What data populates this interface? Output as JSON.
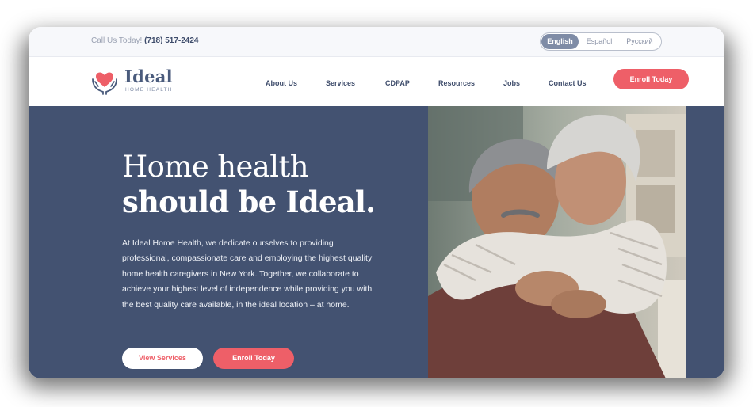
{
  "topbar": {
    "call_label": "Call Us Today!",
    "phone": "(718) 517-2424",
    "languages": [
      {
        "label": "English",
        "active": true
      },
      {
        "label": "Español",
        "active": false
      },
      {
        "label": "Русский",
        "active": false
      }
    ]
  },
  "brand": {
    "name": "Ideal",
    "subtitle": "HOME HEALTH",
    "icon": "heart-in-hands-icon",
    "accent_color": "#ee5f68",
    "navy_color": "#435271"
  },
  "nav": {
    "items": [
      "About Us",
      "Services",
      "CDPAP",
      "Resources",
      "Jobs",
      "Contact Us"
    ],
    "cta": "Enroll Today"
  },
  "hero": {
    "headline_line1": "Home health",
    "headline_line2": "should be Ideal.",
    "description": "At Ideal Home Health, we dedicate ourselves to providing professional, compassionate care and employing the highest quality home health caregivers in New York. Together, we collaborate to achieve your highest level of independence while providing you with the best quality care available, in the ideal location – at home.",
    "primary_button": "View Services",
    "secondary_button": "Enroll Today",
    "image": "elderly-couple-embracing-photo"
  }
}
